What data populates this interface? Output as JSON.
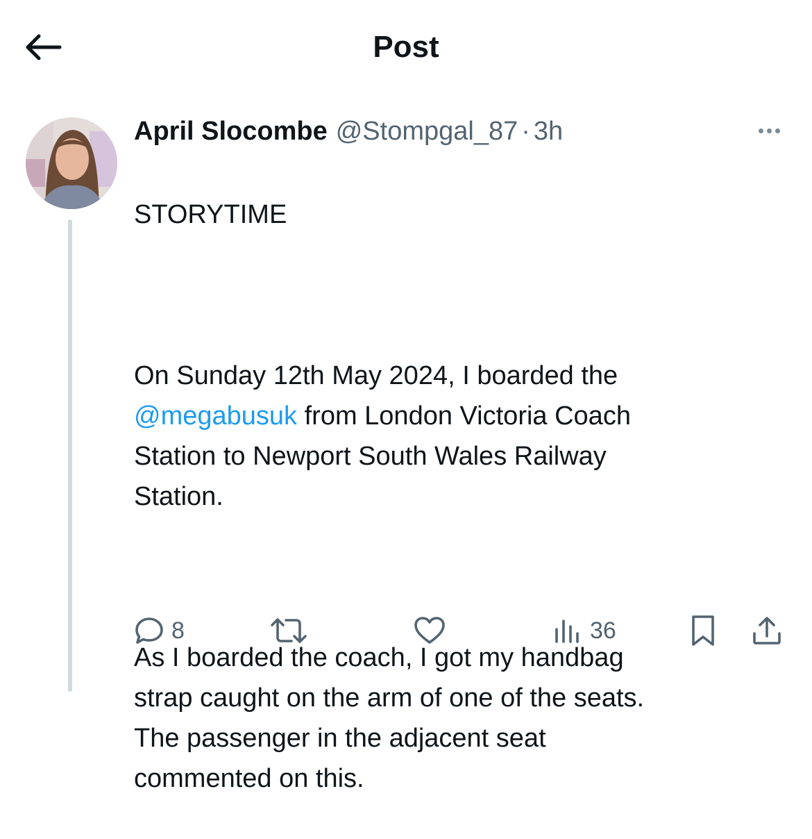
{
  "header": {
    "title": "Post",
    "back_icon": "arrow-left-icon"
  },
  "post": {
    "author": {
      "display_name": "April Slocombe",
      "handle": "@Stompgal_87",
      "separator": "·",
      "time": "3h"
    },
    "text": {
      "line_1": "STORYTIME",
      "para_2_before": "On Sunday 12th May 2024, I boarded the\n",
      "para_2_mention": "@megabusuk",
      "para_2_after": " from London Victoria Coach\nStation to Newport South Wales Railway\nStation.",
      "para_3": "As I boarded the coach, I got my handbag\nstrap caught on the arm of one of the seats.\nThe passenger in the adjacent seat\ncommented on this."
    },
    "actions": {
      "replies": "8",
      "views": "36"
    }
  },
  "colors": {
    "text": "#0f1419",
    "secondary": "#536471",
    "link": "#1d9bf0",
    "thread_line": "#cfd9de"
  }
}
